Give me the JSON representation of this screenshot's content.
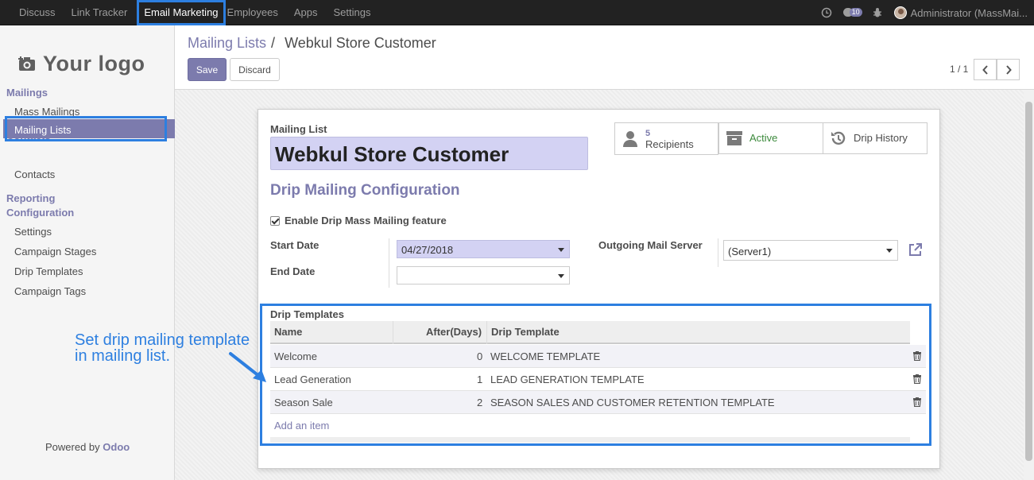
{
  "topbar": {
    "menu": [
      "Discuss",
      "Link Tracker",
      "Email Marketing",
      "Employees",
      "Apps",
      "Settings"
    ],
    "active": "Email Marketing",
    "chat_count": "10",
    "user": "Administrator (MassMai..."
  },
  "sidebar": {
    "logo_text": "Your logo",
    "sections": {
      "mailings": "Mailings",
      "contacts": "Contacts",
      "reporting": "Reporting",
      "configuration": "Configuration"
    },
    "items": {
      "mass_mailings": "Mass Mailings",
      "mailing_lists": "Mailing Lists",
      "contacts": "Contacts",
      "settings": "Settings",
      "campaign_stages": "Campaign Stages",
      "drip_templates": "Drip Templates",
      "campaign_tags": "Campaign Tags"
    },
    "powered_by": "Powered by",
    "powered_brand": "Odoo"
  },
  "control": {
    "breadcrumb_parent": "Mailing Lists",
    "breadcrumb_sep": "/",
    "breadcrumb_current": "Webkul Store Customer",
    "save": "Save",
    "discard": "Discard",
    "pager": "1 / 1"
  },
  "form": {
    "mailing_list_label": "Mailing List",
    "name": "Webkul Store Customer",
    "stat_recipients_count": "5",
    "stat_recipients_label": "Recipients",
    "stat_active": "Active",
    "stat_drip_history": "Drip History",
    "section_title": "Drip Mailing Configuration",
    "enable_label": "Enable Drip Mass Mailing feature",
    "start_date_label": "Start Date",
    "start_date": "04/27/2018",
    "end_date_label": "End Date",
    "end_date": "",
    "outgoing_label": "Outgoing Mail Server",
    "outgoing_value": "(Server1)"
  },
  "drip_table": {
    "title": "Drip Templates",
    "columns": [
      "Name",
      "After(Days)",
      "Drip Template"
    ],
    "rows": [
      {
        "name": "Welcome",
        "days": "0",
        "template": "WELCOME TEMPLATE"
      },
      {
        "name": "Lead Generation",
        "days": "1",
        "template": "LEAD GENERATION TEMPLATE"
      },
      {
        "name": "Season Sale",
        "days": "2",
        "template": "SEASON SALES AND CUSTOMER RETENTION TEMPLATE"
      }
    ],
    "add_item": "Add an item"
  },
  "annotation": {
    "line1": "Set drip mailing template",
    "line2": "in mailing list."
  },
  "colors": {
    "brand": "#7c7bad",
    "highlight": "#2d7fe0",
    "topbar": "#222222",
    "active_green": "#3c8a3c"
  }
}
